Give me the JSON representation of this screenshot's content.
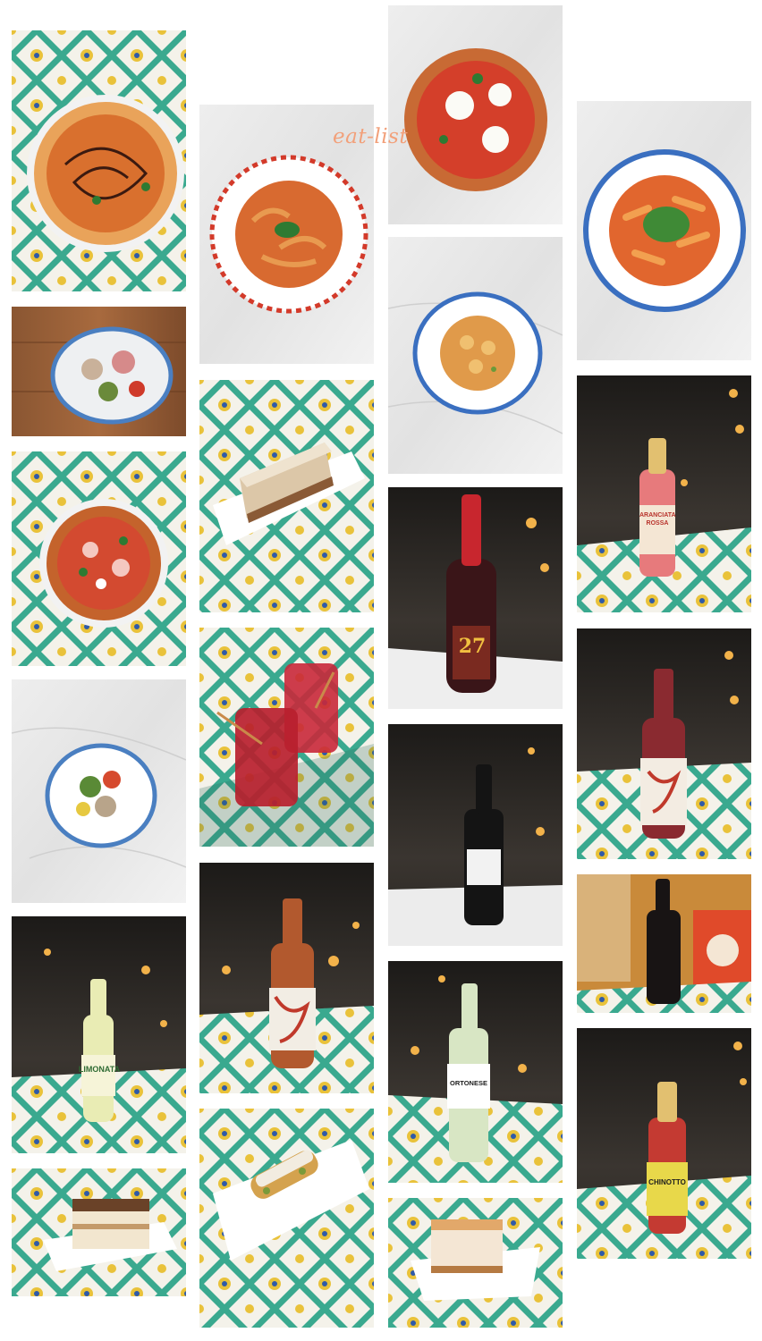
{
  "page": {
    "background": "#ffffff"
  },
  "watermark": {
    "text": "eat-list"
  },
  "tiles": [
    {
      "id": "pizza-balsamic",
      "icon": "pizza-icon"
    },
    {
      "id": "antipasto-wood",
      "icon": "plate-icon"
    },
    {
      "id": "pizza-prosciutto",
      "icon": "pizza-icon"
    },
    {
      "id": "salad-marble",
      "icon": "plate-icon"
    },
    {
      "id": "limonata-bottle",
      "icon": "bottle-icon",
      "label": "LIMONATA"
    },
    {
      "id": "tiramisu-plate",
      "icon": "dessert-icon"
    },
    {
      "id": "pasta-bolognese",
      "icon": "pasta-icon"
    },
    {
      "id": "cake-slice",
      "icon": "dessert-icon"
    },
    {
      "id": "red-juices",
      "icon": "glass-icon"
    },
    {
      "id": "craft-soda-bottle",
      "icon": "bottle-icon"
    },
    {
      "id": "cannolo-plate",
      "icon": "dessert-icon"
    },
    {
      "id": "pizza-burrata",
      "icon": "pizza-icon"
    },
    {
      "id": "gnocchi-plate",
      "icon": "pasta-icon"
    },
    {
      "id": "sparkling-27",
      "icon": "bottle-icon",
      "label": "27"
    },
    {
      "id": "red-wine-bottle",
      "icon": "bottle-icon"
    },
    {
      "id": "ortonese-white",
      "icon": "bottle-icon",
      "label": "ORTONESE"
    },
    {
      "id": "cheesecake-plate",
      "icon": "dessert-icon"
    },
    {
      "id": "penne-arrabbiata",
      "icon": "pasta-icon"
    },
    {
      "id": "aranciata-rossa",
      "icon": "bottle-icon",
      "label": "ARANCIATA ROSSA"
    },
    {
      "id": "beer-bottle",
      "icon": "bottle-icon"
    },
    {
      "id": "ortonese-dark",
      "icon": "bottle-icon"
    },
    {
      "id": "chinotto-bottle",
      "icon": "bottle-icon",
      "label": "CHINOTTO"
    }
  ]
}
